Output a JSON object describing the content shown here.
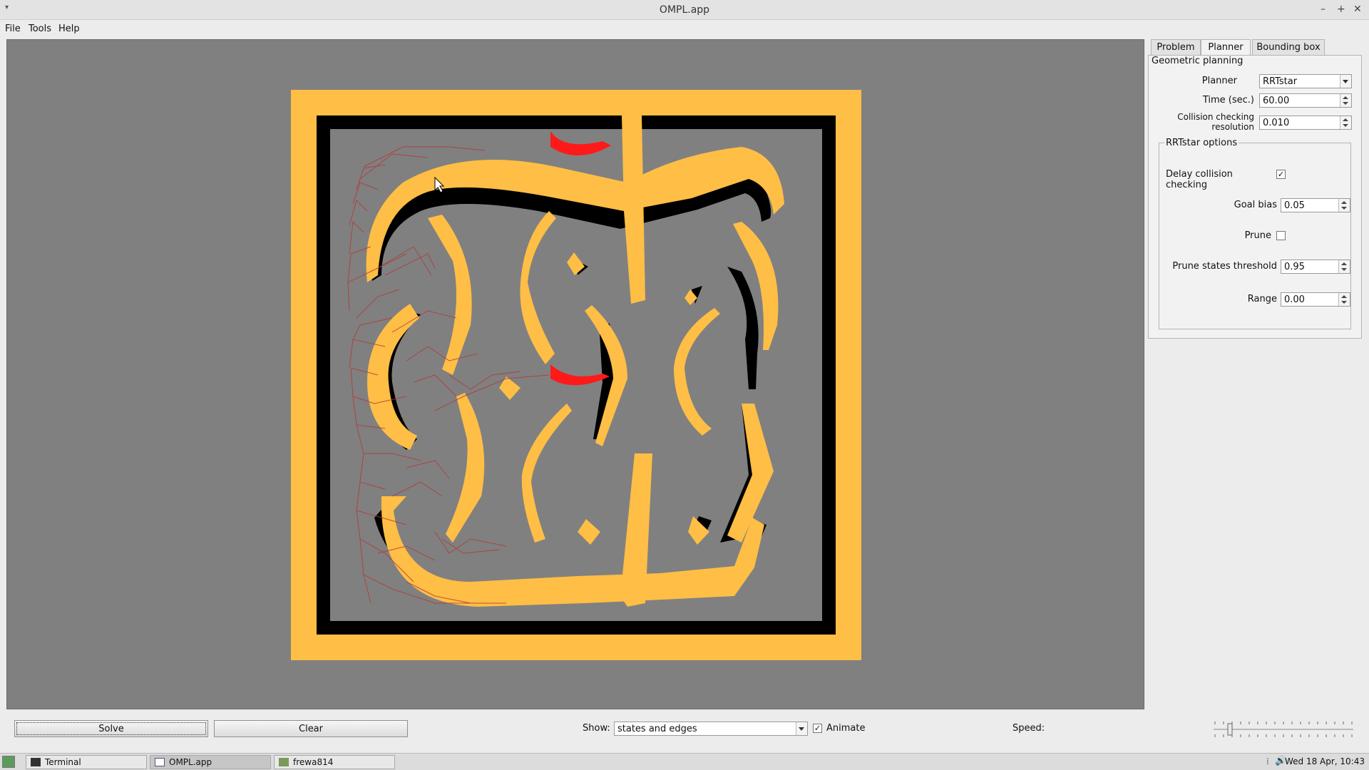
{
  "window": {
    "title": "OMPL.app",
    "min": "–",
    "max": "+",
    "close": "✕"
  },
  "menu": {
    "file": "File",
    "tools": "Tools",
    "help": "Help"
  },
  "tabs": {
    "problem": "Problem",
    "planner": "Planner",
    "bbox": "Bounding box"
  },
  "planner_panel": {
    "group_title": "Geometric planning",
    "planner_label": "Planner",
    "planner_value": "RRTstar",
    "time_label": "Time (sec.)",
    "time_value": "60.00",
    "ccr_label_1": "Collision checking",
    "ccr_label_2": "resolution",
    "ccr_value": "0.010",
    "options_title": "RRTstar options",
    "delay_label": "Delay collision checking",
    "delay_checked": true,
    "goal_bias_label": "Goal bias",
    "goal_bias_value": "0.05",
    "prune_label": "Prune",
    "prune_checked": false,
    "prune_threshold_label": "Prune states threshold",
    "prune_threshold_value": "0.95",
    "range_label": "Range",
    "range_value": "0.00"
  },
  "bottom": {
    "solve": "Solve",
    "clear": "Clear",
    "show_label": "Show:",
    "show_value": "states and edges",
    "animate_label": "Animate",
    "animate_checked": true,
    "speed_label": "Speed:"
  },
  "taskbar": {
    "items": [
      "Terminal",
      "OMPL.app",
      "frewa814"
    ],
    "clock": "Wed 18 Apr, 10:43"
  },
  "colors": {
    "obstacle": "#ffbe45",
    "wall": "#000000",
    "floor": "#808080",
    "robot": "#ff1a1a",
    "tree": "#b33a3a"
  }
}
